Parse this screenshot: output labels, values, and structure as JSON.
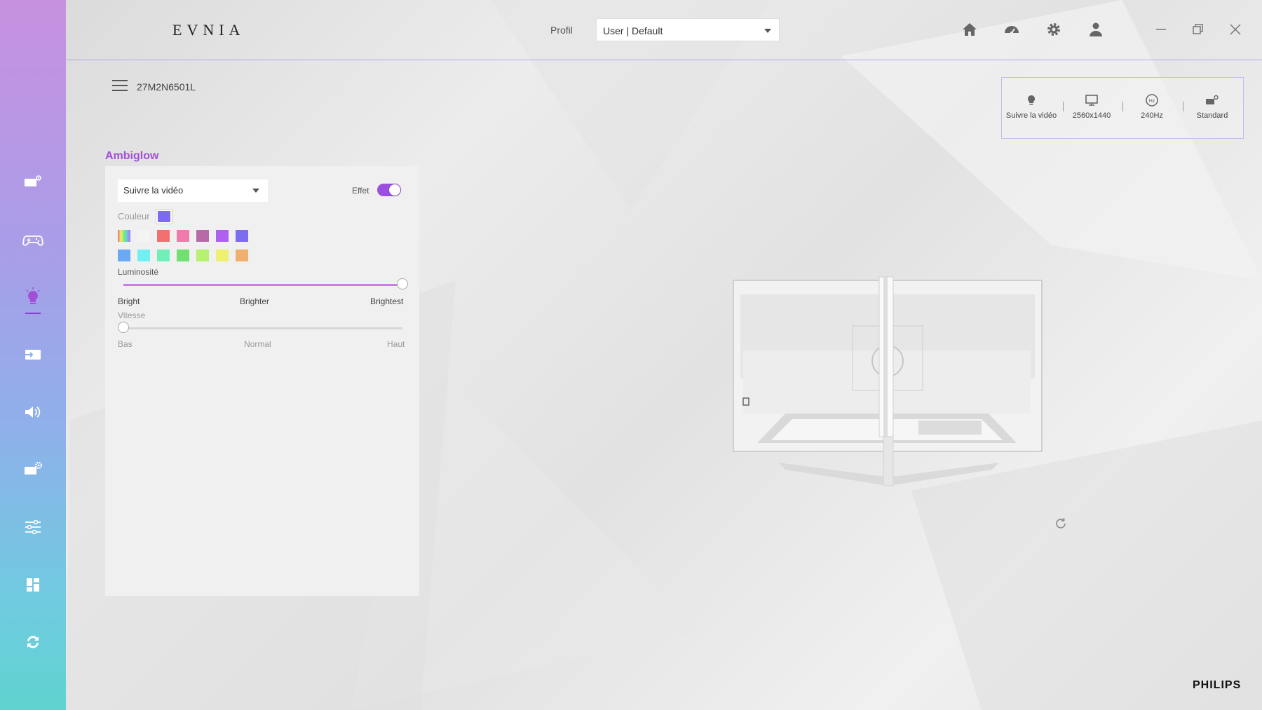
{
  "app": {
    "logo": "EVNIA",
    "brand": "PHILIPS"
  },
  "header": {
    "profil_label": "Profil",
    "profile_value": "User | Default",
    "icons": [
      "home-icon",
      "gauge-icon",
      "gear-icon",
      "user-icon"
    ],
    "window_controls": [
      "minimize-icon",
      "restore-icon",
      "close-icon"
    ]
  },
  "device": {
    "model": "27M2N6501L"
  },
  "status": {
    "items": [
      {
        "icon": "bulb-icon",
        "label": "Suivre la vidéo"
      },
      {
        "icon": "monitor-icon",
        "label": "2560x1440"
      },
      {
        "icon": "hz-icon",
        "label": "240Hz"
      },
      {
        "icon": "picture-mode-icon",
        "label": "Standard"
      }
    ]
  },
  "sidebar": {
    "items": [
      {
        "name": "picture-mode",
        "icon": "monitor-sparkle-icon"
      },
      {
        "name": "gaming",
        "icon": "gamepad-icon"
      },
      {
        "name": "ambiglow",
        "icon": "bulb-icon",
        "active": true
      },
      {
        "name": "input",
        "icon": "input-icon"
      },
      {
        "name": "audio",
        "icon": "speaker-icon"
      },
      {
        "name": "setup",
        "icon": "monitor-gear-icon"
      },
      {
        "name": "adjust",
        "icon": "sliders-icon"
      },
      {
        "name": "layout",
        "icon": "grid-icon"
      },
      {
        "name": "update",
        "icon": "sync-icon"
      }
    ]
  },
  "ambiglow": {
    "title": "Ambiglow",
    "mode_value": "Suivre la vidéo",
    "effet_label": "Effet",
    "effet_on": true,
    "couleur_label": "Couleur",
    "current_color": "#7b6cf0",
    "swatches_row1": [
      "rainbow",
      "#f4f4f4",
      "#f07070",
      "#f07aaa",
      "#b86aa8",
      "#b060f0",
      "#7b6cf0"
    ],
    "swatches_row2": [
      "#6aaaf4",
      "#70f0f0",
      "#70f0b8",
      "#70e070",
      "#b8f070",
      "#f0f070",
      "#f0b070"
    ],
    "luminosite": {
      "label": "Luminosité",
      "value": 1.0,
      "ticks": [
        "Bright",
        "Brighter",
        "Brightest"
      ]
    },
    "vitesse": {
      "label": "Vitesse",
      "value": 0.0,
      "ticks": [
        "Bas",
        "Normal",
        "Haut"
      ]
    }
  },
  "accent_color": "#9b4fe0"
}
